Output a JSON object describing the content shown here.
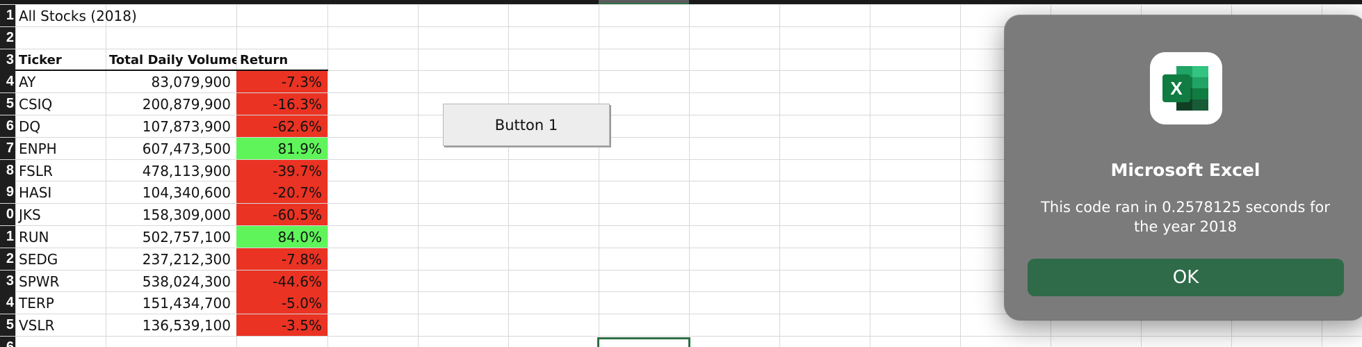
{
  "sheet": {
    "title_cell": "All Stocks (2018)",
    "headers": {
      "ticker": "Ticker",
      "volume": "Total Daily Volume",
      "return": "Return"
    },
    "row_numbers": [
      "1",
      "2",
      "3",
      "4",
      "5",
      "6",
      "7",
      "8",
      "9",
      "0",
      "1",
      "2",
      "3",
      "4",
      "5",
      "6"
    ],
    "rows": [
      {
        "ticker": "AY",
        "volume": "83,079,900",
        "return": "-7.3%",
        "status": "negative"
      },
      {
        "ticker": "CSIQ",
        "volume": "200,879,900",
        "return": "-16.3%",
        "status": "negative"
      },
      {
        "ticker": "DQ",
        "volume": "107,873,900",
        "return": "-62.6%",
        "status": "negative"
      },
      {
        "ticker": "ENPH",
        "volume": "607,473,500",
        "return": "81.9%",
        "status": "positive"
      },
      {
        "ticker": "FSLR",
        "volume": "478,113,900",
        "return": "-39.7%",
        "status": "negative"
      },
      {
        "ticker": "HASI",
        "volume": "104,340,600",
        "return": "-20.7%",
        "status": "negative"
      },
      {
        "ticker": "JKS",
        "volume": "158,309,000",
        "return": "-60.5%",
        "status": "negative"
      },
      {
        "ticker": "RUN",
        "volume": "502,757,100",
        "return": "84.0%",
        "status": "positive"
      },
      {
        "ticker": "SEDG",
        "volume": "237,212,300",
        "return": "-7.8%",
        "status": "negative"
      },
      {
        "ticker": "SPWR",
        "volume": "538,024,300",
        "return": "-44.6%",
        "status": "negative"
      },
      {
        "ticker": "TERP",
        "volume": "151,434,700",
        "return": "-5.0%",
        "status": "negative"
      },
      {
        "ticker": "VSLR",
        "volume": "136,539,100",
        "return": "-3.5%",
        "status": "negative"
      }
    ]
  },
  "button": {
    "label": "Button 1"
  },
  "dialog": {
    "app_name": "Microsoft Excel",
    "icon": "excel-icon",
    "icon_letter": "X",
    "message": "This code ran in 0.2578125 seconds for the year 2018",
    "ok_label": "OK"
  },
  "colors": {
    "positive": "#5ff55a",
    "negative": "#ea3323",
    "dialog_bg": "#7b7b7b",
    "ok_button": "#2f6b48",
    "selection": "#2e6f45"
  }
}
